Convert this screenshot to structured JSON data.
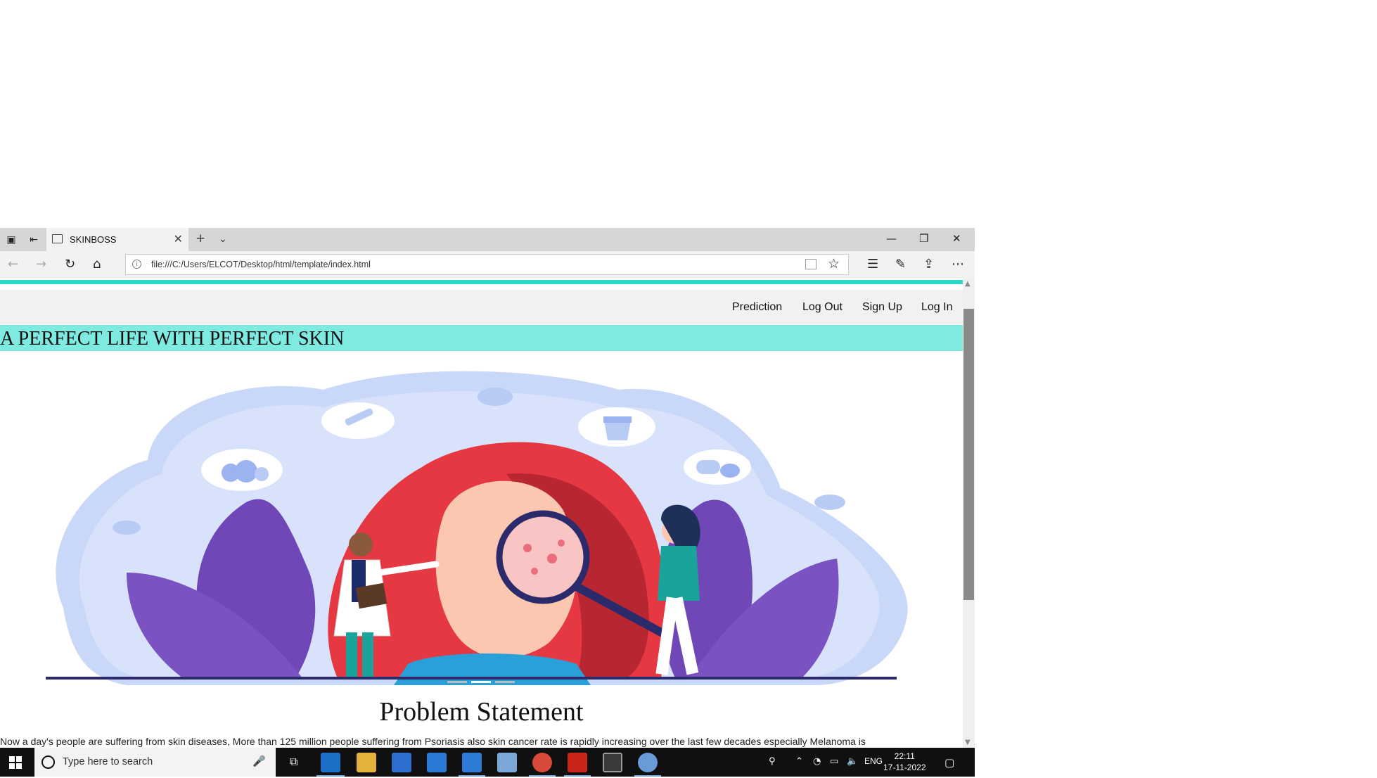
{
  "browser": {
    "tab_title": "SKINBOSS",
    "url": "file:///C:/Users/ELCOT/Desktop/html/template/index.html"
  },
  "nav": {
    "links": [
      "Prediction",
      "Log Out",
      "Sign Up",
      "Log In"
    ]
  },
  "banner": {
    "text": "A PERFECT LIFE WITH PERFECT SKIN"
  },
  "section": {
    "heading": "Problem Statement",
    "paragraph": "Now a day's people are suffering from skin diseases, More than 125 million people suffering from Psoriasis also skin cancer rate is rapidly increasing over the last few decades especially Melanoma is"
  },
  "taskbar": {
    "search_placeholder": "Type here to search",
    "language": "ENG",
    "time": "22:11",
    "date": "17-11-2022"
  },
  "colors": {
    "accent_teal": "#2ed6c8",
    "banner_bg": "#7eeae0",
    "nav_bg": "#f1f1f1"
  }
}
